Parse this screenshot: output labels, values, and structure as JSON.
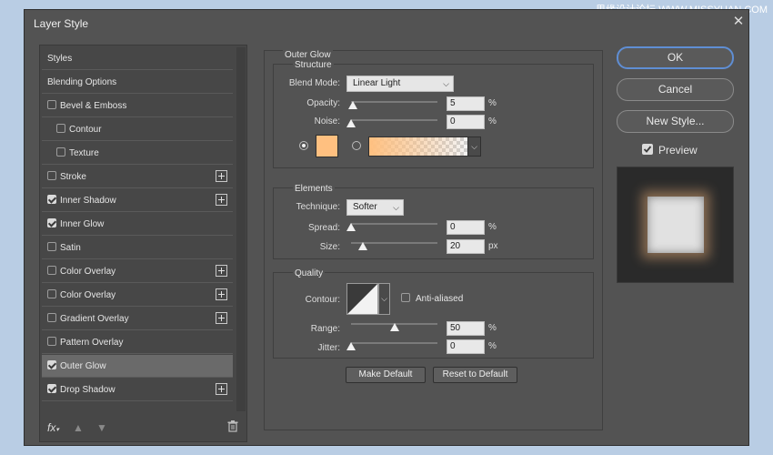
{
  "window": {
    "title": "Layer Style",
    "close_icon": "close-icon"
  },
  "watermark": "思缘设计论坛 WWW.MISSYUAN.COM",
  "styles_list": [
    {
      "label": "Styles",
      "checkbox": false,
      "checked": false,
      "plus": false,
      "selected": false,
      "indent": 0
    },
    {
      "label": "Blending Options",
      "checkbox": false,
      "checked": false,
      "plus": false,
      "selected": false,
      "indent": 0
    },
    {
      "label": "Bevel & Emboss",
      "checkbox": true,
      "checked": false,
      "plus": false,
      "selected": false,
      "indent": 0
    },
    {
      "label": "Contour",
      "checkbox": true,
      "checked": false,
      "plus": false,
      "selected": false,
      "indent": 1
    },
    {
      "label": "Texture",
      "checkbox": true,
      "checked": false,
      "plus": false,
      "selected": false,
      "indent": 1
    },
    {
      "label": "Stroke",
      "checkbox": true,
      "checked": false,
      "plus": true,
      "selected": false,
      "indent": 0
    },
    {
      "label": "Inner Shadow",
      "checkbox": true,
      "checked": true,
      "plus": true,
      "selected": false,
      "indent": 0
    },
    {
      "label": "Inner Glow",
      "checkbox": true,
      "checked": true,
      "plus": false,
      "selected": false,
      "indent": 0
    },
    {
      "label": "Satin",
      "checkbox": true,
      "checked": false,
      "plus": false,
      "selected": false,
      "indent": 0
    },
    {
      "label": "Color Overlay",
      "checkbox": true,
      "checked": false,
      "plus": true,
      "selected": false,
      "indent": 0
    },
    {
      "label": "Color Overlay",
      "checkbox": true,
      "checked": false,
      "plus": true,
      "selected": false,
      "indent": 0
    },
    {
      "label": "Gradient Overlay",
      "checkbox": true,
      "checked": false,
      "plus": true,
      "selected": false,
      "indent": 0
    },
    {
      "label": "Pattern Overlay",
      "checkbox": true,
      "checked": false,
      "plus": false,
      "selected": false,
      "indent": 0
    },
    {
      "label": "Outer Glow",
      "checkbox": true,
      "checked": true,
      "plus": false,
      "selected": true,
      "indent": 0
    },
    {
      "label": "Drop Shadow",
      "checkbox": true,
      "checked": true,
      "plus": true,
      "selected": false,
      "indent": 0
    }
  ],
  "bottom_tools": {
    "fx": "fx",
    "up_icon": "arrow-up-icon",
    "down_icon": "arrow-down-icon",
    "trash_icon": "trash-icon"
  },
  "outer_glow": {
    "title": "Outer Glow",
    "structure": {
      "title": "Structure",
      "blend_mode_label": "Blend Mode:",
      "blend_mode": "Linear Light",
      "opacity_label": "Opacity:",
      "opacity": "5",
      "opacity_unit": "%",
      "noise_label": "Noise:",
      "noise": "0",
      "noise_unit": "%",
      "glow_color": "#ffc080",
      "gradient_from": "#ffc080"
    },
    "elements": {
      "title": "Elements",
      "technique_label": "Technique:",
      "technique": "Softer",
      "spread_label": "Spread:",
      "spread": "0",
      "spread_unit": "%",
      "size_label": "Size:",
      "size": "20",
      "size_unit": "px"
    },
    "quality": {
      "title": "Quality",
      "contour_label": "Contour:",
      "anti_aliased_label": "Anti-aliased",
      "anti_aliased": false,
      "range_label": "Range:",
      "range": "50",
      "range_unit": "%",
      "jitter_label": "Jitter:",
      "jitter": "0",
      "jitter_unit": "%"
    },
    "make_default": "Make Default",
    "reset_default": "Reset to Default"
  },
  "right": {
    "ok": "OK",
    "cancel": "Cancel",
    "new_style": "New Style...",
    "preview_label": "Preview",
    "preview_checked": true
  }
}
